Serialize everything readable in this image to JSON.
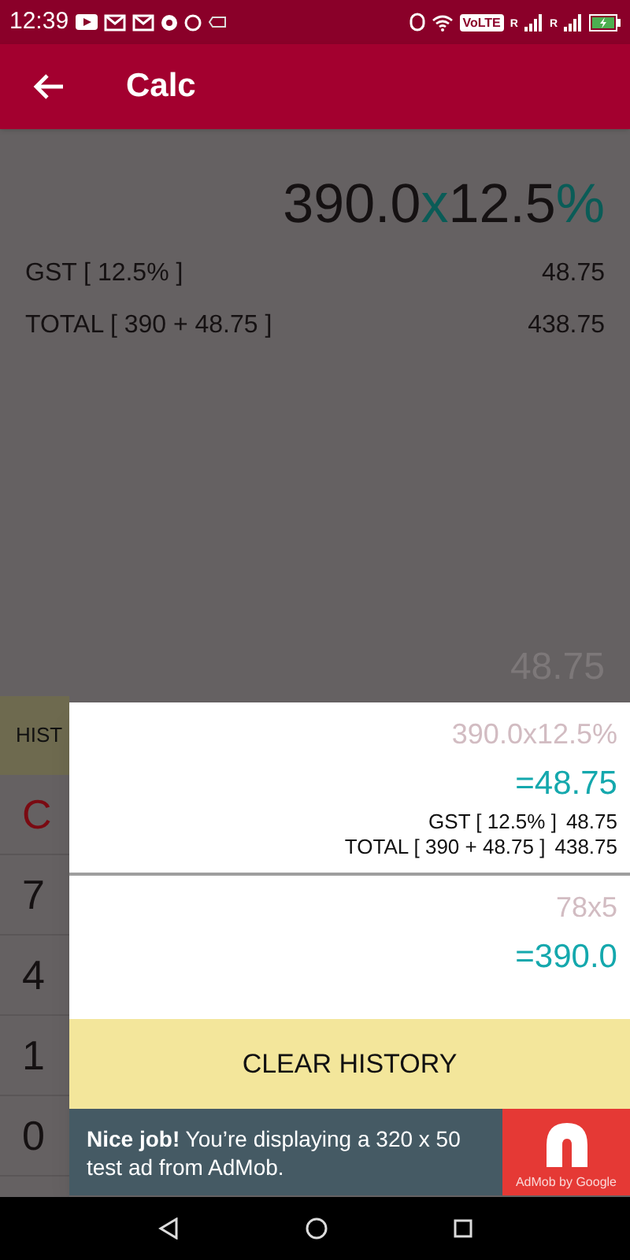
{
  "status_bar": {
    "time": "12:39",
    "network": "VoLTE",
    "roaming": [
      "R",
      "R"
    ]
  },
  "app_bar": {
    "title": "Calc"
  },
  "display": {
    "expression": [
      {
        "text": "390.0",
        "kind": "number"
      },
      {
        "text": "x",
        "kind": "operator"
      },
      {
        "text": "12.5",
        "kind": "number"
      },
      {
        "text": "%",
        "kind": "operator"
      }
    ],
    "rows": [
      {
        "label": "GST [ 12.5% ]",
        "value": "48.75"
      },
      {
        "label": "TOTAL [ 390 + 48.75 ]",
        "value": "438.75"
      }
    ],
    "result": "48.75"
  },
  "history_tab": {
    "label": "HIST"
  },
  "keypad": [
    {
      "label": "C",
      "kind": "clear"
    },
    {
      "label": "7",
      "kind": "digit"
    },
    {
      "label": "4",
      "kind": "digit"
    },
    {
      "label": "1",
      "kind": "digit"
    },
    {
      "label": "0",
      "kind": "digit"
    }
  ],
  "history": [
    {
      "expression": "390.0x12.5%",
      "result": "=48.75",
      "details": [
        {
          "label": "GST [ 12.5% ]",
          "value": "48.75"
        },
        {
          "label": "TOTAL [ 390 + 48.75 ]",
          "value": "438.75"
        }
      ]
    },
    {
      "expression": "78x5",
      "result": "=390.0"
    }
  ],
  "clear_button": "CLEAR HISTORY",
  "ad": {
    "headline": "Nice job!",
    "text": "You’re displaying a 320 x 50 test ad from AdMob.",
    "brand": "AdMob by Google"
  }
}
